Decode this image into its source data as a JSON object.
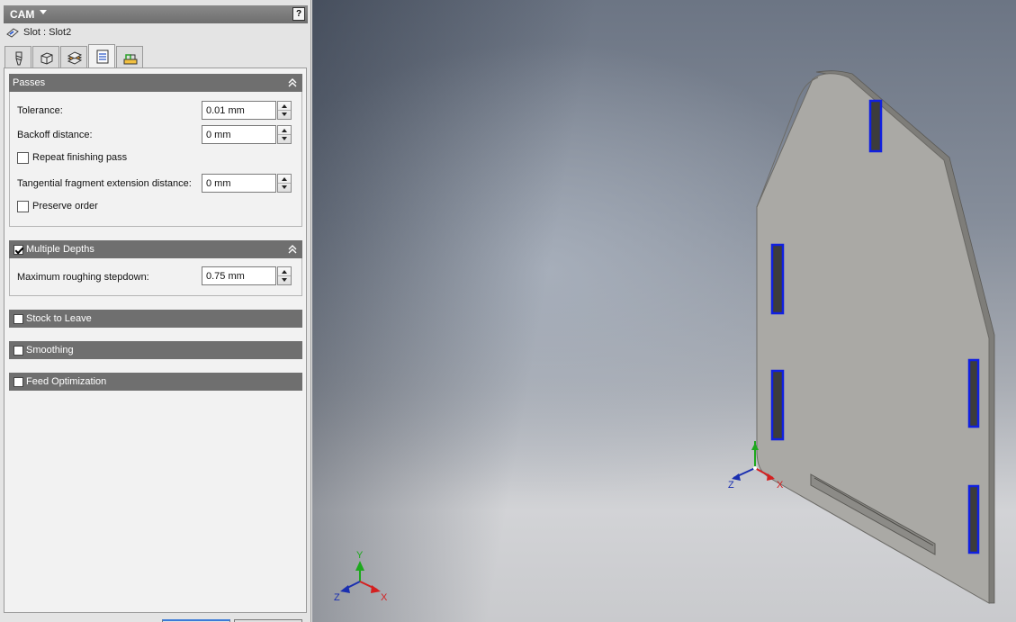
{
  "panel": {
    "title": "CAM",
    "help_label": "?",
    "operation_label": "Slot : Slot2"
  },
  "tabs": [
    {
      "name": "tool",
      "icon": "tool-icon"
    },
    {
      "name": "geometry",
      "icon": "geometry-icon"
    },
    {
      "name": "heights",
      "icon": "heights-icon"
    },
    {
      "name": "passes",
      "icon": "passes-icon",
      "active": true
    },
    {
      "name": "linking",
      "icon": "linking-icon"
    }
  ],
  "passes": {
    "title": "Passes",
    "tolerance_label": "Tolerance:",
    "tolerance_value": "0.01 mm",
    "backoff_label": "Backoff distance:",
    "backoff_value": "0 mm",
    "repeat_finishing_label": "Repeat finishing pass",
    "tangential_label": "Tangential fragment extension distance:",
    "tangential_value": "0 mm",
    "preserve_order_label": "Preserve order"
  },
  "multiple_depths": {
    "title": "Multiple Depths",
    "checked": true,
    "max_stepdown_label": "Maximum roughing stepdown:",
    "max_stepdown_value": "0.75 mm"
  },
  "stock_to_leave": {
    "title": "Stock to Leave",
    "checked": false
  },
  "smoothing": {
    "title": "Smoothing",
    "checked": false
  },
  "feed_optimization": {
    "title": "Feed Optimization",
    "checked": false
  },
  "triad": {
    "x_label": "X",
    "y_label": "Y",
    "z_label": "Z",
    "x_color": "#d42020",
    "y_color": "#1ea81e",
    "z_color": "#1a2fb0"
  },
  "colors": {
    "header": "#6f6f6f",
    "slot_toolpath": "#1020e0",
    "plate": "#a9a8a4"
  }
}
